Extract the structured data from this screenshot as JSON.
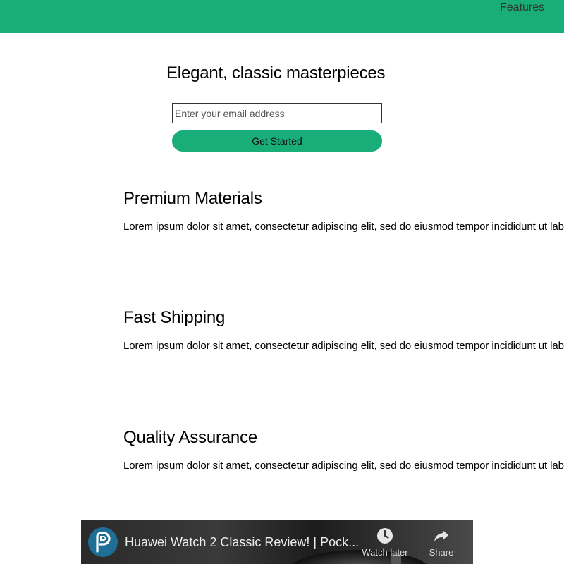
{
  "nav": {
    "features_label": "Features"
  },
  "hero": {
    "title": "Elegant, classic masterpieces",
    "email_placeholder": "Enter your email address",
    "cta_label": "Get Started"
  },
  "features": [
    {
      "title": "Premium Materials",
      "text": "Lorem ipsum dolor sit amet, consectetur adipiscing elit, sed do eiusmod tempor incididunt ut labore et dolore magna aliqua."
    },
    {
      "title": "Fast Shipping",
      "text": "Lorem ipsum dolor sit amet, consectetur adipiscing elit, sed do eiusmod tempor incididunt ut labore et dolore magna aliqua."
    },
    {
      "title": "Quality Assurance",
      "text": "Lorem ipsum dolor sit amet, consectetur adipiscing elit, sed do eiusmod tempor incididunt ut labore et dolore magna aliqua."
    }
  ],
  "video": {
    "title": "Huawei Watch 2 Classic Review! | Pock...",
    "watch_later_label": "Watch later",
    "share_label": "Share",
    "channel_icon": "pocketnow-logo-icon"
  },
  "colors": {
    "brand": "#18ad79",
    "channel": "#1f6e96"
  }
}
